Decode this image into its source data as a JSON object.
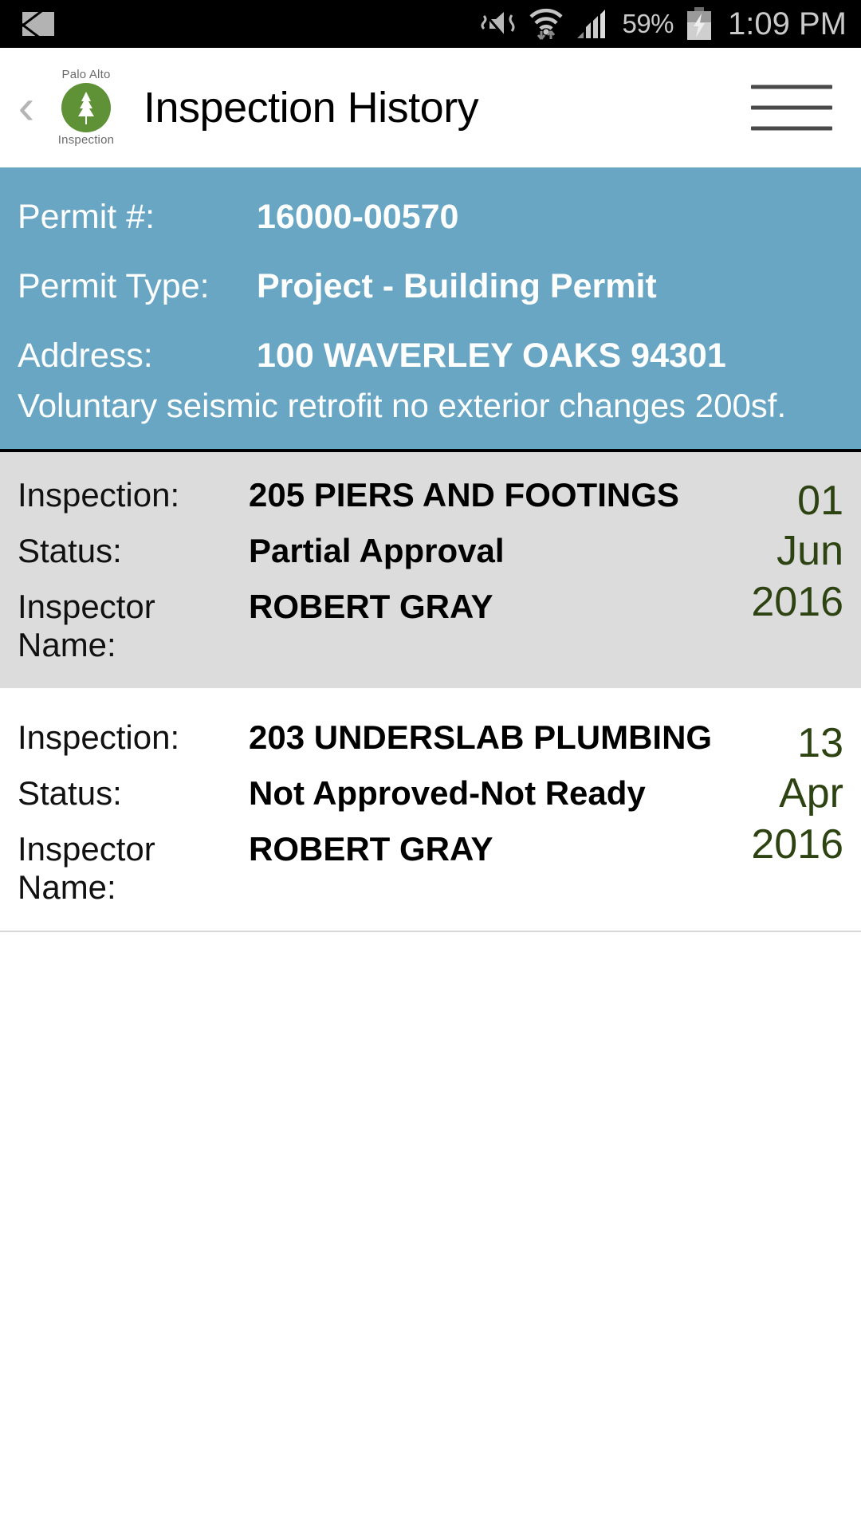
{
  "statusbar": {
    "mail_icon": "envelope-icon",
    "vibrate_icon": "vibrate-mute-icon",
    "wifi_icon": "wifi-icon",
    "signal_icon": "signal-bars-icon",
    "battery_percent": "59%",
    "battery_icon": "battery-charging-icon",
    "time": "1:09 PM"
  },
  "appbar": {
    "back_label": "‹",
    "logo": {
      "top_text": "Palo Alto",
      "bottom_text": "Inspection"
    },
    "title": "Inspection History",
    "menu_icon": "hamburger-menu-icon"
  },
  "permit": {
    "rows": [
      {
        "label": "Permit #:",
        "value": "16000-00570"
      },
      {
        "label": "Permit Type:",
        "value": "Project - Building Permit"
      },
      {
        "label": "Address:",
        "value": "100  WAVERLEY OAKS   94301"
      }
    ],
    "description": "Voluntary seismic retrofit no exterior changes 200sf.",
    "background_color": "#68a6c4"
  },
  "records": [
    {
      "inspection_label": "Inspection:",
      "inspection_value": "205 PIERS AND FOOTINGS",
      "status_label": "Status:",
      "status_value": "Partial Approval",
      "inspector_label": "Inspector Name:",
      "inspector_value": "ROBERT GRAY",
      "day": "01",
      "month": "Jun",
      "year": "2016"
    },
    {
      "inspection_label": "Inspection:",
      "inspection_value": "203 UNDERSLAB PLUMBING",
      "status_label": "Status:",
      "status_value": "Not Approved-Not Ready",
      "inspector_label": "Inspector Name:",
      "inspector_value": "ROBERT GRAY",
      "day": "13",
      "month": "Apr",
      "year": "2016"
    }
  ],
  "colors": {
    "accent_blue": "#68a6c4",
    "row_gray": "#dcdcdc",
    "date_green": "#2e4312",
    "logo_green": "#5f9136"
  }
}
